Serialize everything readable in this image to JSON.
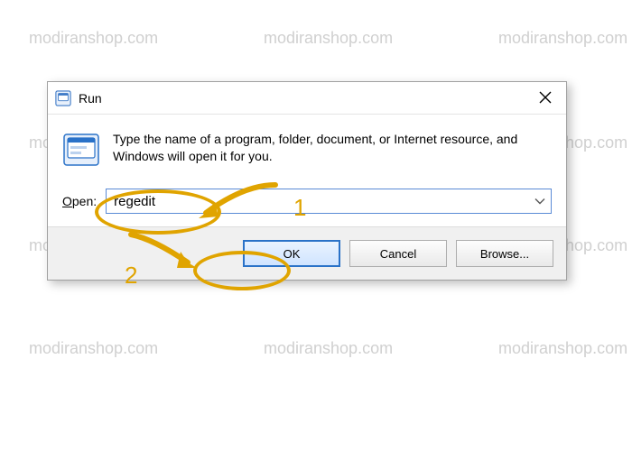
{
  "watermark_text": "modiranshop.com",
  "dialog": {
    "title": "Run",
    "message": "Type the name of a program, folder, document, or Internet resource, and Windows will open it for you.",
    "open_label_pre": "O",
    "open_label_rest": "pen:",
    "input_value": "regedit",
    "ok_label": "OK",
    "cancel_label": "Cancel",
    "browse_label": "Browse..."
  },
  "annotations": {
    "step1": "1",
    "step2": "2"
  },
  "colors": {
    "highlight": "#e0a400",
    "border_focus": "#2a72c8"
  }
}
